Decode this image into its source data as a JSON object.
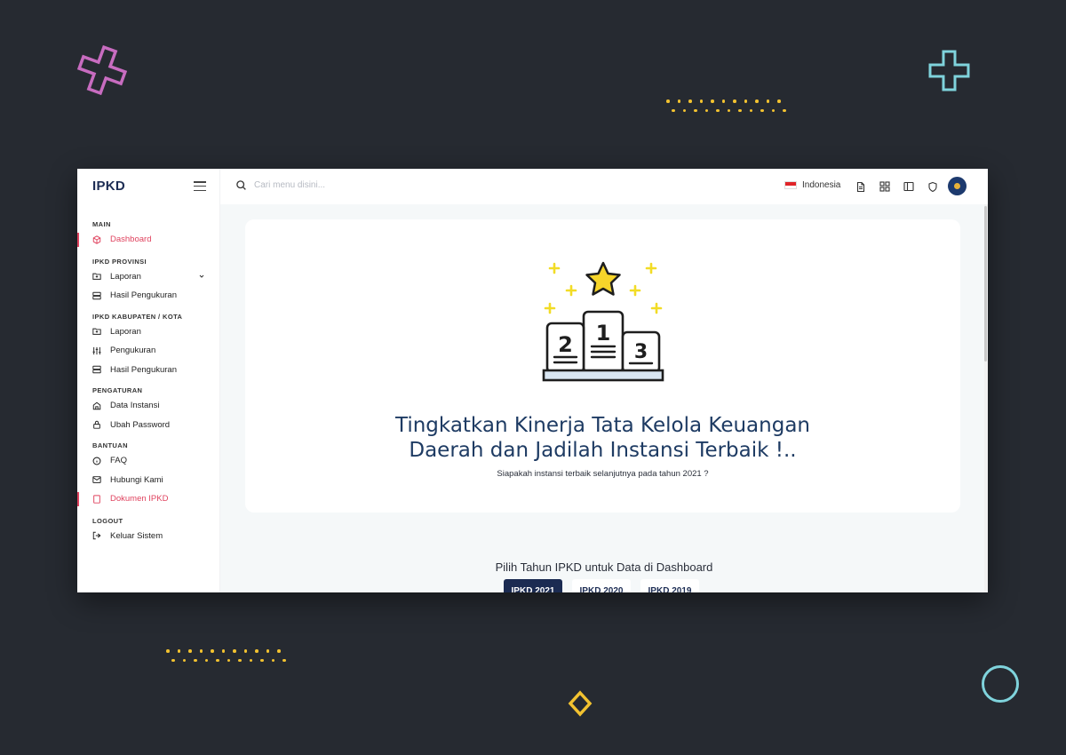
{
  "app": {
    "brand": "IPKD"
  },
  "search": {
    "placeholder": "Cari menu disini..."
  },
  "topbar": {
    "language": "Indonesia"
  },
  "sidebar": {
    "sections": [
      {
        "title": "MAIN",
        "items": [
          {
            "label": "Dashboard",
            "icon": "box-icon",
            "active": true
          }
        ]
      },
      {
        "title": "IPKD PROVINSI",
        "items": [
          {
            "label": "Laporan",
            "icon": "folder-plus-icon",
            "expandable": true
          },
          {
            "label": "Hasil Pengukuran",
            "icon": "server-icon"
          }
        ]
      },
      {
        "title": "IPKD KABUPATEN / KOTA",
        "items": [
          {
            "label": "Laporan",
            "icon": "folder-plus-icon"
          },
          {
            "label": "Pengukuran",
            "icon": "sliders-icon"
          },
          {
            "label": "Hasil Pengukuran",
            "icon": "server-icon"
          }
        ]
      },
      {
        "title": "PENGATURAN",
        "items": [
          {
            "label": "Data Instansi",
            "icon": "home-icon"
          },
          {
            "label": "Ubah Password",
            "icon": "lock-icon"
          }
        ]
      },
      {
        "title": "BANTUAN",
        "items": [
          {
            "label": "FAQ",
            "icon": "info-icon"
          },
          {
            "label": "Hubungi Kami",
            "icon": "mail-icon"
          },
          {
            "label": "Dokumen IPKD",
            "icon": "book-icon",
            "active": true
          }
        ]
      },
      {
        "title": "LOGOUT",
        "items": [
          {
            "label": "Keluar Sistem",
            "icon": "log-out-icon"
          }
        ]
      }
    ]
  },
  "hero": {
    "headline_line1": "Tingkatkan Kinerja Tata Kelola Keuangan",
    "headline_line2": "Daerah dan Jadilah Instansi Terbaik !..",
    "subtitle": "Siapakah instansi terbaik selanjutnya pada tahun 2021 ?",
    "podium_numbers": [
      "2",
      "1",
      "3"
    ]
  },
  "years": {
    "title": "Pilih Tahun IPKD untuk Data di Dashboard",
    "options": [
      {
        "label": "IPKD 2021",
        "active": true
      },
      {
        "label": "IPKD 2020",
        "active": false
      },
      {
        "label": "IPKD 2019",
        "active": false
      }
    ]
  },
  "colors": {
    "accent": "#e0435f",
    "brand": "#1d2d54",
    "background": "#262a31"
  }
}
